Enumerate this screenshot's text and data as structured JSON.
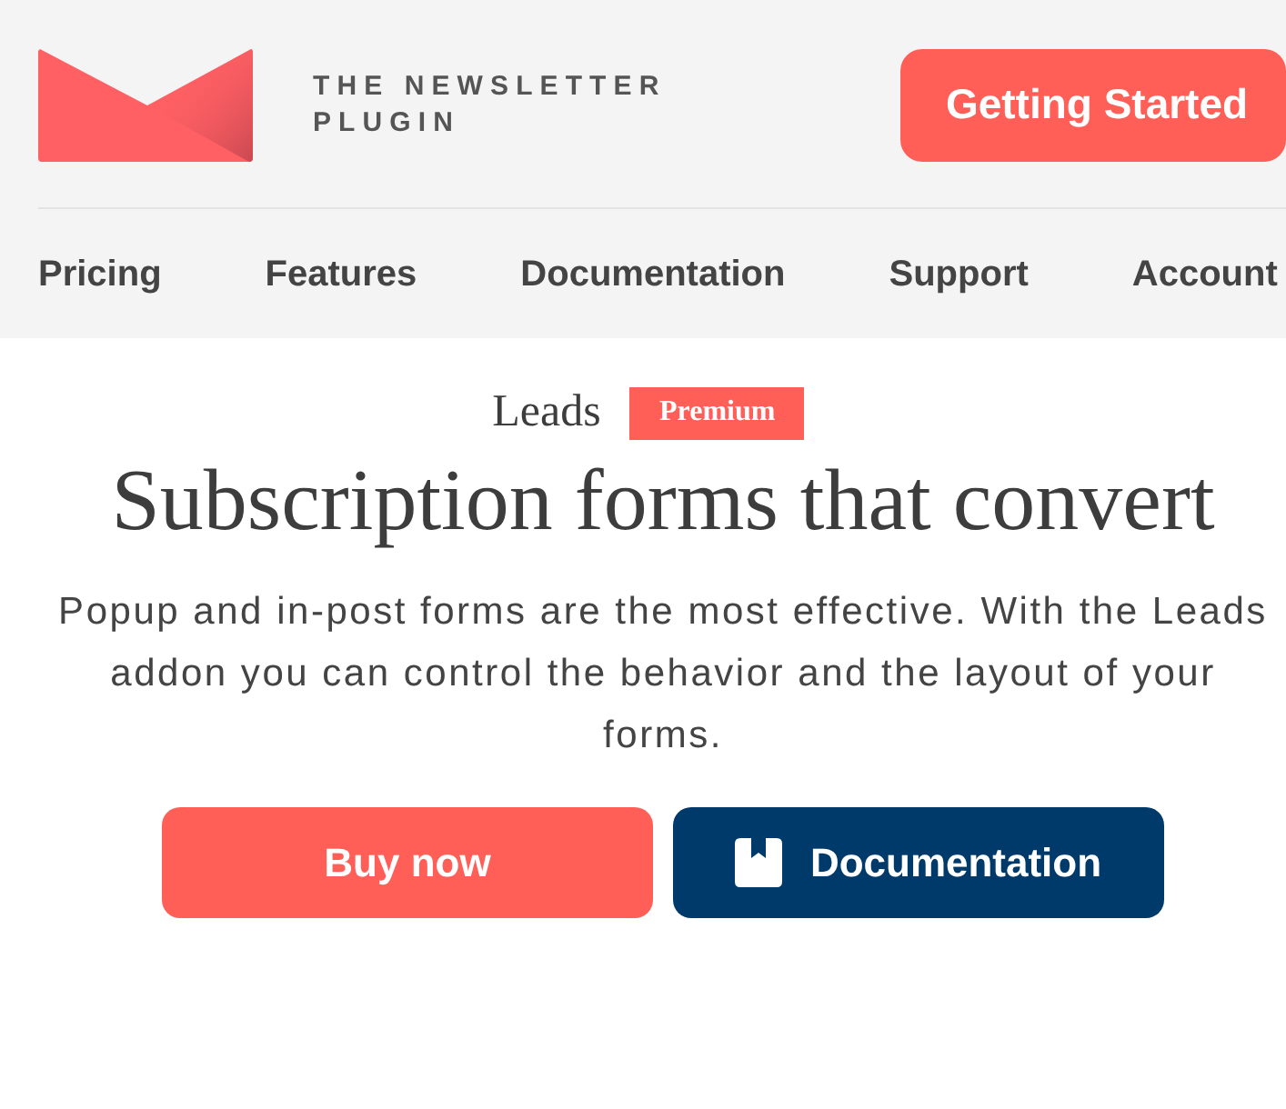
{
  "header": {
    "brand": "THE NEWSLETTER PLUGIN",
    "cta": "Getting Started",
    "nav": [
      "Pricing",
      "Features",
      "Documentation",
      "Support",
      "Account"
    ]
  },
  "hero": {
    "eyebrow": "Leads",
    "badge": "Premium",
    "title": "Subscription forms that convert",
    "description": [
      "Popup and in-post forms are the most effective. With the Leads",
      "addon you can control the behavior and the layout of your",
      "forms."
    ],
    "buttons": [
      {
        "label": "Buy now",
        "kind": "primary"
      },
      {
        "label": "Documentation",
        "kind": "docs"
      }
    ]
  }
}
